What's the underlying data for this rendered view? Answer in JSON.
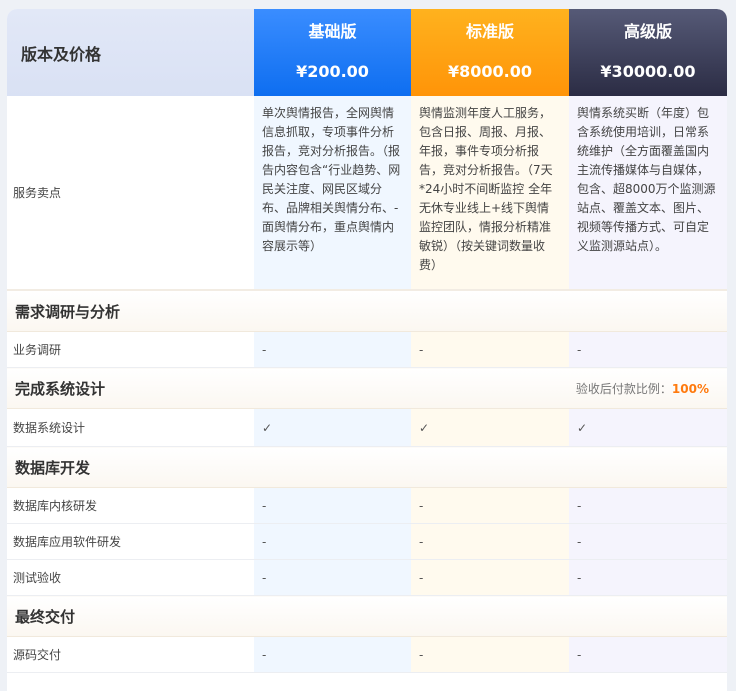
{
  "header": {
    "label": "版本及价格",
    "plans": [
      {
        "name": "基础版",
        "price": "¥200.00"
      },
      {
        "name": "标准版",
        "price": "¥8000.00"
      },
      {
        "name": "高级版",
        "price": "¥30000.00"
      }
    ]
  },
  "features": {
    "label": "服务卖点",
    "basic": "单次舆情报告，全网舆情信息抓取，专项事件分析报告，竞对分析报告。（报告内容包含“行业趋势、网民关注度、网民区域分布、品牌相关舆情分布、-面舆情分布，重点舆情内容展示等）",
    "standard": "舆情监测年度人工服务，包含日报、周报、月报、年报，事件专项分析报告，竞对分析报告。（7天*24小时不间断监控 全年无休专业线上+线下舆情监控团队，情报分析精准敏锐）（按关键词数量收费）",
    "premium": "舆情系统买断（年度）包含系统使用培训，日常系统维护（全方面覆盖国内主流传播媒体与自媒体，包含、超8000万个监测源站点、覆盖文本、图片、视频等传播方式、可自定义监测源站点）。"
  },
  "sections": {
    "s1": {
      "title": "需求调研与分析",
      "items": [
        {
          "label": "业务调研",
          "basic": "-",
          "standard": "-",
          "premium": "-"
        }
      ]
    },
    "s2": {
      "title": "完成系统设计",
      "note_prefix": "验收后付款比例：",
      "note_value": "100%",
      "items": [
        {
          "label": "数据系统设计",
          "basic": "✓",
          "standard": "✓",
          "premium": "✓"
        }
      ]
    },
    "s3": {
      "title": "数据库开发",
      "items": [
        {
          "label": "数据库内核研发",
          "basic": "-",
          "standard": "-",
          "premium": "-"
        },
        {
          "label": "数据库应用软件研发",
          "basic": "-",
          "standard": "-",
          "premium": "-"
        },
        {
          "label": "测试验收",
          "basic": "-",
          "standard": "-",
          "premium": "-"
        }
      ]
    },
    "s4": {
      "title": "最终交付",
      "items": [
        {
          "label": "源码交付",
          "basic": "-",
          "standard": "-",
          "premium": "-"
        }
      ]
    }
  },
  "colors": {
    "basic": "#1677ff",
    "standard": "#ffa00f",
    "premium": "#3a3b55",
    "accent": "#ff7a0e",
    "check": "#12a05c"
  }
}
